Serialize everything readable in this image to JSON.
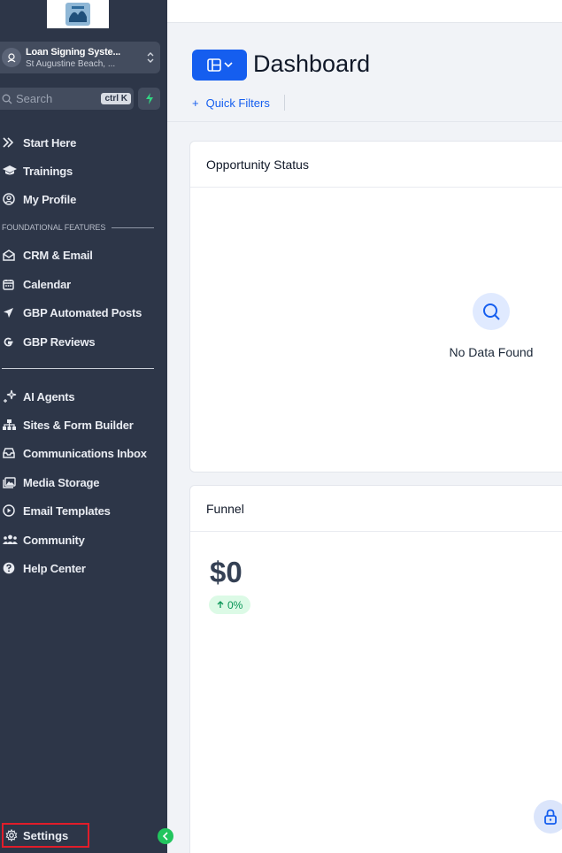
{
  "sidebar": {
    "account": {
      "name": "Loan Signing Syste...",
      "location": "St Augustine Beach, ..."
    },
    "search": {
      "placeholder": "Search",
      "shortcut": "ctrl K"
    },
    "items_top": [
      {
        "label": "Start Here",
        "icon": "double-chevron-right-icon"
      },
      {
        "label": "Trainings",
        "icon": "graduation-cap-icon"
      },
      {
        "label": "My Profile",
        "icon": "user-circle-icon"
      }
    ],
    "section_label": "FOUNDATIONAL FEATURES",
    "items_foundational": [
      {
        "label": "CRM & Email",
        "icon": "mail-open-icon"
      },
      {
        "label": "Calendar",
        "icon": "calendar-icon"
      },
      {
        "label": "GBP Automated Posts",
        "icon": "send-icon"
      },
      {
        "label": "GBP Reviews",
        "icon": "google-icon"
      }
    ],
    "items_more": [
      {
        "label": "AI Agents",
        "icon": "sparkles-icon"
      },
      {
        "label": "Sites & Form Builder",
        "icon": "sitemap-icon"
      },
      {
        "label": "Communications Inbox",
        "icon": "inbox-icon"
      },
      {
        "label": "Media Storage",
        "icon": "images-icon"
      },
      {
        "label": "Email Templates",
        "icon": "play-circle-icon"
      },
      {
        "label": "Community",
        "icon": "users-icon"
      },
      {
        "label": "Help Center",
        "icon": "help-circle-icon"
      }
    ],
    "settings_label": "Settings"
  },
  "header": {
    "title": "Dashboard",
    "quick_filters_label": "Quick Filters"
  },
  "cards": {
    "opportunity_status": {
      "title": "Opportunity Status",
      "empty_text": "No Data Found"
    },
    "funnel": {
      "title": "Funnel",
      "amount": "$0",
      "change": "0%"
    }
  },
  "colors": {
    "sidebar_bg": "#2d3648",
    "accent": "#155eef",
    "settings_highlight": "#e11d2a",
    "positive": "#079455"
  }
}
